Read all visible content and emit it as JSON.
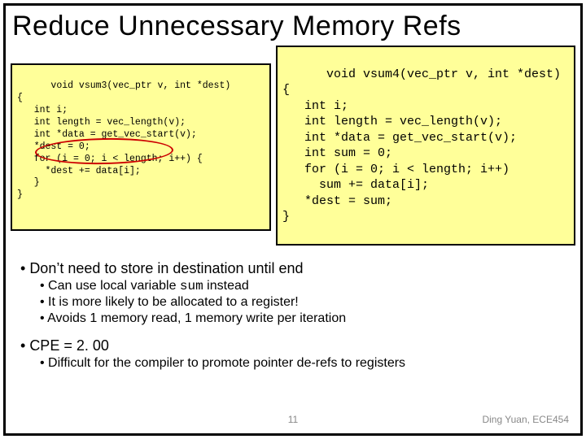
{
  "title": "Reduce Unnecessary Memory Refs",
  "code_left": "void vsum3(vec_ptr v, int *dest)\n{\n   int i;\n   int length = vec_length(v);\n   int *data = get_vec_start(v);\n   *dest = 0;\n   for (i = 0; i < length; i++) {\n     *dest += data[i];\n   }\n}",
  "code_right": "void vsum4(vec_ptr v, int *dest)\n{\n   int i;\n   int length = vec_length(v);\n   int *data = get_vec_start(v);\n   int sum = 0;\n   for (i = 0; i < length; i++)\n     sum += data[i];\n   *dest = sum;\n}",
  "bullets": {
    "p1": "Don’t need to store in destination until end",
    "p1a_pre": "Can use local variable ",
    "p1a_code": "sum",
    "p1a_post": " instead",
    "p1b": "It is more likely to be allocated to a register!",
    "p1c": "Avoids 1 memory read, 1 memory write per iteration",
    "p2": "CPE = 2. 00",
    "p2a": "Difficult for the compiler to promote pointer de-refs to registers"
  },
  "footer": {
    "page": "11",
    "credit": "Ding Yuan, ECE454"
  }
}
